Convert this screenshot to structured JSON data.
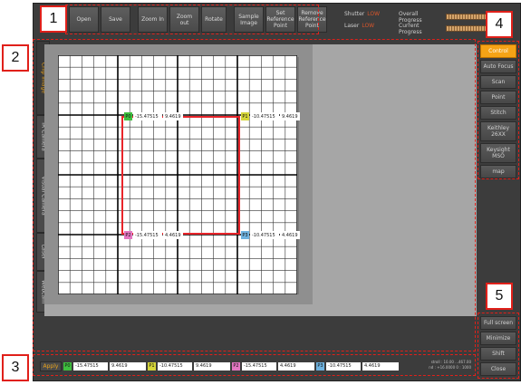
{
  "annotations": [
    "1",
    "2",
    "3",
    "4",
    "5"
  ],
  "toolbar": [
    {
      "label": "Open",
      "name": "open-button"
    },
    {
      "label": "Save",
      "name": "save-button"
    },
    {
      "label": "Zoom In",
      "name": "zoom-in-button"
    },
    {
      "label": "Zoom out",
      "name": "zoom-out-button"
    },
    {
      "label": "Rotate",
      "name": "rotate-button"
    },
    {
      "label": "Sample Image",
      "name": "sample-image-button"
    },
    {
      "label": "Set Reference Point",
      "name": "set-reference-point-button"
    },
    {
      "label": "Remove Reference Point",
      "name": "remove-reference-point-button"
    }
  ],
  "status": {
    "shutter_label": "Shutter",
    "shutter_value": "LOW",
    "laser_label": "Laser",
    "laser_value": "LOW"
  },
  "progress": {
    "overall_label": "Overall Progress",
    "overall_fraction": 1.0,
    "current_label": "Current Progress",
    "current_fraction": 1.0
  },
  "left_tabs": [
    "Chip Image",
    "IR Camera",
    "Visual Camera",
    "Laser",
    "Webcam"
  ],
  "active_left_tab": 0,
  "right_buttons": [
    "Control",
    "Auto Focus",
    "Scan",
    "Point",
    "Stitch",
    "Keithley 26XX",
    "Keysight MSO",
    "map"
  ],
  "active_right_button": 0,
  "right_bottom_buttons": [
    "Full screen",
    "Minimize",
    "Shift",
    "Close"
  ],
  "points": [
    {
      "id": "P0",
      "x": "-15.47515",
      "y": "9.4619",
      "color": "#3fbf3f"
    },
    {
      "id": "P1",
      "x": "-10.47515",
      "y": "9.4619",
      "color": "#d6d63a"
    },
    {
      "id": "P2",
      "x": "-15.47515",
      "y": "4.4619",
      "color": "#e377c2"
    },
    {
      "id": "P3",
      "x": "-10.47515",
      "y": "4.4619",
      "color": "#6fb3e0"
    }
  ],
  "bottom": {
    "apply_label": "Apply"
  },
  "coords_readout": [
    "stroll : 10.00   ...467.00",
    "nd : +16.0000   0 : 1000"
  ],
  "colors": {
    "accent": "#f5a316",
    "selection": "#e8242a"
  }
}
